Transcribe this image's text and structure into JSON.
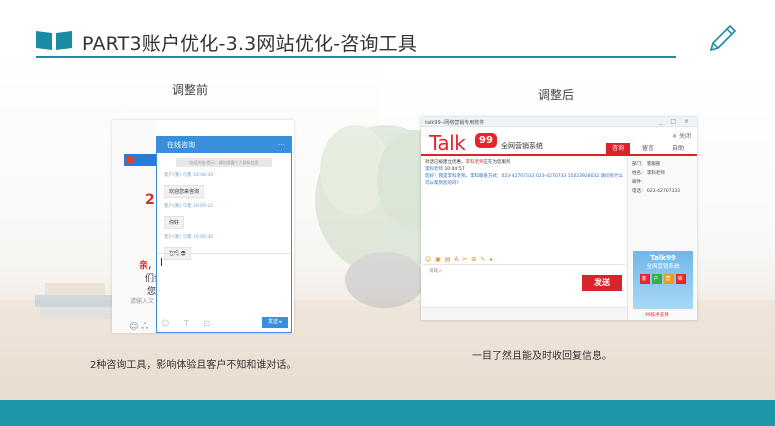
{
  "header": {
    "title": "PART3账户优化-3.3网站优化-咨询工具",
    "icons": {
      "left": "open-book-icon",
      "right": "pencil-icon"
    },
    "accent_color": "#1a8ca3"
  },
  "before": {
    "label": "调整前",
    "caption": "2种咨询工具，影响体验且客户不知和谁对话。",
    "page_text": {
      "num": "2",
      "side1": "亲,",
      "side2": "们会",
      "side3": "您.",
      "side4": "请输入文"
    },
    "chat": {
      "title": "在线咨询",
      "menu_icon": "…",
      "notice": "欢迎光临·提示：请勿泄露个人隐私信息",
      "messages": [
        {
          "meta": "客户(我) 乌鲁 10:08:30",
          "text": "欢迎您来咨询"
        },
        {
          "meta": "客户(我) 乌鲁 10:09:22",
          "text": "你好"
        },
        {
          "meta": "客户(我) 乌鲁 10:09:36",
          "text": "在吗 ☻"
        }
      ],
      "tools": "☺ T ⊡",
      "send_label": "发送 ▸"
    }
  },
  "after": {
    "label": "调整后",
    "caption": "一目了然且能及时收回复信息。",
    "window_title": "talk99--网络营销专用软件",
    "window_controls": "_ □ ×",
    "logo_text": "Talk",
    "logo_badge": "99",
    "logo_sub": "全网营销系统",
    "close_label": "✕ 关闭",
    "tabs": [
      {
        "label": "咨询",
        "active": true
      },
      {
        "label": "留言",
        "active": false
      },
      {
        "label": "自助",
        "active": false
      }
    ],
    "messages": {
      "line1_a": "对话已被建立优惠，",
      "line1_red": "李科老师",
      "line1_b": "正在为您服务",
      "line2_name": "李科老师",
      "line2_time": "10:44:57",
      "line3": "您好！我是李科老师，李科联系方式：023-42707333 023-4270733  15023928032 请问有什么可以帮到您的吗？"
    },
    "info": {
      "dept": "部门：  客服部",
      "name": "姓名：  李科老师",
      "email": "邮件：",
      "phone": "电话：  023-42707333"
    },
    "ad": {
      "title": "Talk99",
      "sub": "全网营销系统",
      "blocks": [
        "客",
        "户",
        "营",
        "销"
      ],
      "footer": "99技术支持"
    },
    "toolbar": "☺ ▣ ▤ A ✂ ⊞ ✎ ◂",
    "input_placeholder": "请输入",
    "send_label": "发送"
  },
  "colors": {
    "footer": "#1d96a8",
    "brand_red": "#d8242a",
    "chat_blue": "#3a8fdc"
  }
}
